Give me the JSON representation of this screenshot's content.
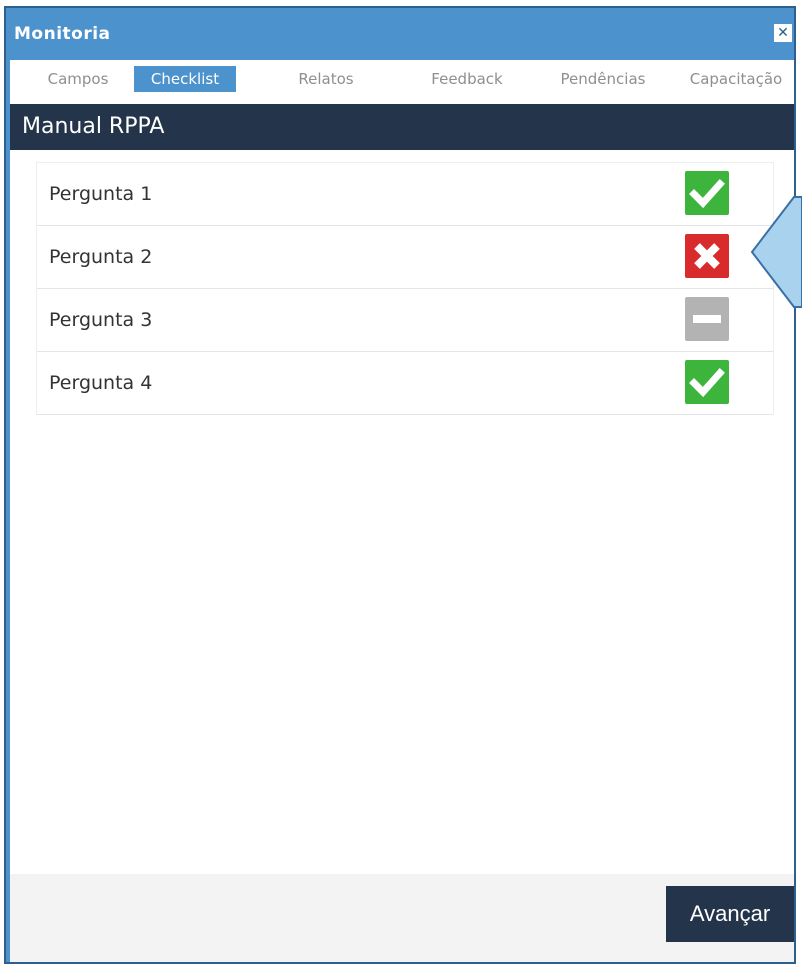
{
  "window": {
    "title": "Monitoria",
    "close_glyph": "✕"
  },
  "tabs": [
    {
      "label": "Campos",
      "active": false
    },
    {
      "label": "Checklist",
      "active": true
    },
    {
      "label": "Relatos",
      "active": false
    },
    {
      "label": "Feedback",
      "active": false
    },
    {
      "label": "Pendências",
      "active": false
    },
    {
      "label": "Capacitação",
      "active": false
    }
  ],
  "section": {
    "title": "Manual RPPA"
  },
  "questions": [
    {
      "label": "Pergunta 1",
      "status": "approved",
      "icon": "check-icon"
    },
    {
      "label": "Pergunta 2",
      "status": "rejected",
      "icon": "x-icon"
    },
    {
      "label": "Pergunta 3",
      "status": "not-applicable",
      "icon": "minus-icon"
    },
    {
      "label": "Pergunta 4",
      "status": "approved",
      "icon": "check-icon"
    }
  ],
  "footer": {
    "next_label": "Avançar"
  },
  "colors": {
    "titlebar": "#4c92cc",
    "header": "#24344a",
    "approved": "#3db53d",
    "rejected": "#d92b2b",
    "not_applicable": "#b3b3b3",
    "callout_fill": "#a9d2ee",
    "callout_border": "#3a6fa5"
  }
}
